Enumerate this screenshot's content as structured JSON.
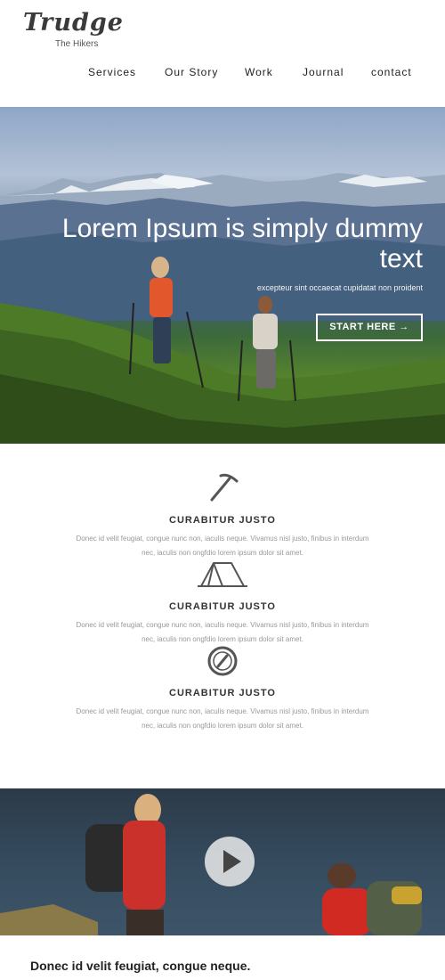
{
  "brand": {
    "title": "Trudge",
    "subtitle": "The Hikers"
  },
  "nav": {
    "items": [
      {
        "label": "Services"
      },
      {
        "label": "Our Story"
      },
      {
        "label": "Work"
      },
      {
        "label": "Journal"
      },
      {
        "label": "contact"
      }
    ]
  },
  "hero": {
    "title": "Lorem Ipsum is simply dummy text",
    "subtitle": "excepteur sint occaecat cupidatat non proident",
    "button_label": "START HERE →"
  },
  "features": [
    {
      "icon": "ice-axe-icon",
      "title": "CURABITUR JUSTO",
      "text": "Donec id velit feugiat, congue nunc non, iaculis neque. Vivamus nisl justo, finibus in interdum nec, iaculis non ongfdio lorem ipsum dolor sit amet."
    },
    {
      "icon": "tent-icon",
      "title": "CURABITUR JUSTO",
      "text": "Donec id velit feugiat, congue nunc non, iaculis neque. Vivamus nisl justo, finibus in interdum nec, iaculis non ongfdio lorem ipsum dolor sit amet."
    },
    {
      "icon": "compass-icon",
      "title": "CURABITUR JUSTO",
      "text": "Donec id velit feugiat, congue nunc non, iaculis neque. Vivamus nisl justo, finibus in interdum nec, iaculis non ongfdio lorem ipsum dolor sit amet."
    }
  ],
  "video": {
    "play_icon": "play-icon"
  },
  "bottom": {
    "heading": "Donec id velit feugiat, congue neque."
  },
  "colors": {
    "accent": "#ffffff",
    "text_dark": "#222222",
    "text_muted": "#999999",
    "icon_gray": "#555555"
  }
}
